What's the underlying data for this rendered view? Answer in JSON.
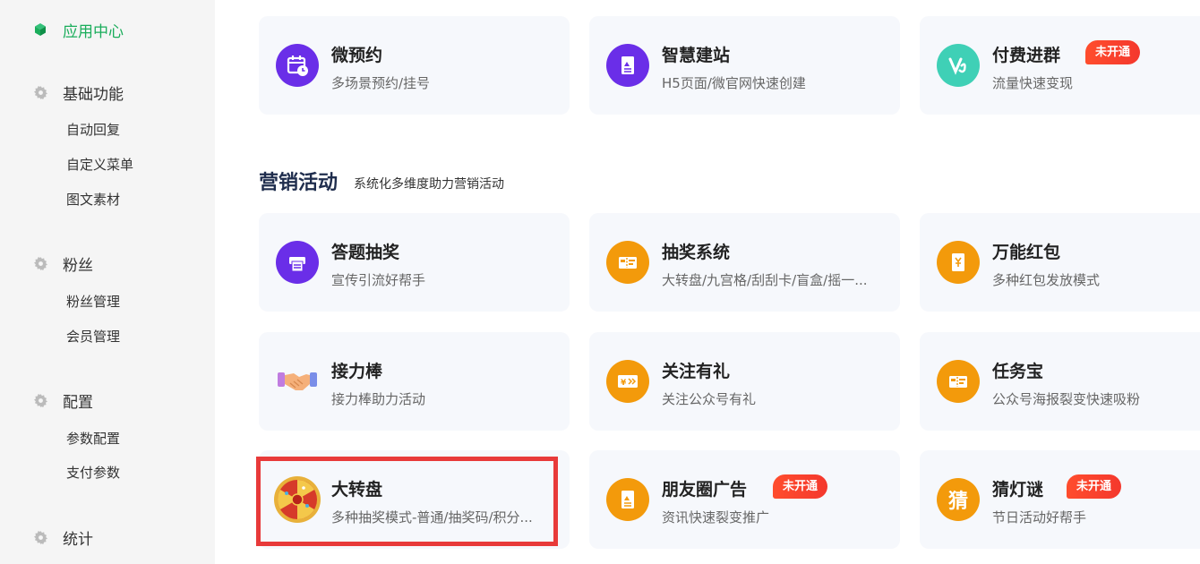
{
  "sidebar": {
    "top": {
      "label": "应用中心",
      "icon": "cube-icon",
      "color": "#1aad5b"
    },
    "groups": [
      {
        "label": "基础功能",
        "icon": "gear-icon",
        "items": [
          "自动回复",
          "自定义菜单",
          "图文素材"
        ]
      },
      {
        "label": "粉丝",
        "icon": "gear-icon",
        "items": [
          "粉丝管理",
          "会员管理"
        ]
      },
      {
        "label": "配置",
        "icon": "gear-icon",
        "items": [
          "参数配置",
          "支付参数"
        ]
      },
      {
        "label": "统计",
        "icon": "gear-icon",
        "items": []
      }
    ]
  },
  "top_cards": [
    {
      "title": "微预约",
      "desc": "多场景预约/挂号",
      "icon": "calendar-icon",
      "color": "#6a2ee8"
    },
    {
      "title": "智慧建站",
      "desc": "H5页面/微官网快速创建",
      "icon": "document-icon",
      "color": "#6a2ee8"
    },
    {
      "title": "付费进群",
      "desc": "流量快速变现",
      "icon": "vip-icon",
      "color": "#3fd0b6",
      "badge": "未开通"
    }
  ],
  "section": {
    "title": "营销活动",
    "subtitle": "系统化多维度助力营销活动"
  },
  "cards": [
    {
      "title": "答题抽奖",
      "desc": "宣传引流好帮手",
      "icon": "printer-icon",
      "color": "#6a2ee8"
    },
    {
      "title": "抽奖系统",
      "desc": "大转盘/九宫格/刮刮卡/盲盒/摇一...",
      "icon": "ticket-icon",
      "color": "#f39a0b"
    },
    {
      "title": "万能红包",
      "desc": "多种红包发放模式",
      "icon": "red-packet-icon",
      "color": "#f39a0b"
    },
    {
      "title": "接力棒",
      "desc": "接力棒助力活动",
      "icon": "handshake-icon",
      "color": "#f5b07a"
    },
    {
      "title": "关注有礼",
      "desc": "关注公众号有礼",
      "icon": "coupon-icon",
      "color": "#f39a0b"
    },
    {
      "title": "任务宝",
      "desc": "公众号海报裂变快速吸粉",
      "icon": "ticket-icon",
      "color": "#f39a0b"
    },
    {
      "title": "大转盘",
      "desc": "多种抽奖模式-普通/抽奖码/积分...",
      "icon": "lucky-wheel-icon",
      "color": "#d63a2a",
      "highlighted": true
    },
    {
      "title": "朋友圈广告",
      "desc": "资讯快速裂变推广",
      "icon": "document-icon",
      "color": "#f39a0b",
      "badge": "未开通"
    },
    {
      "title": "猜灯谜",
      "desc": "节日活动好帮手",
      "icon": "riddle-icon",
      "color": "#f39a0b",
      "badge": "未开通",
      "icon_text": "猜"
    }
  ]
}
